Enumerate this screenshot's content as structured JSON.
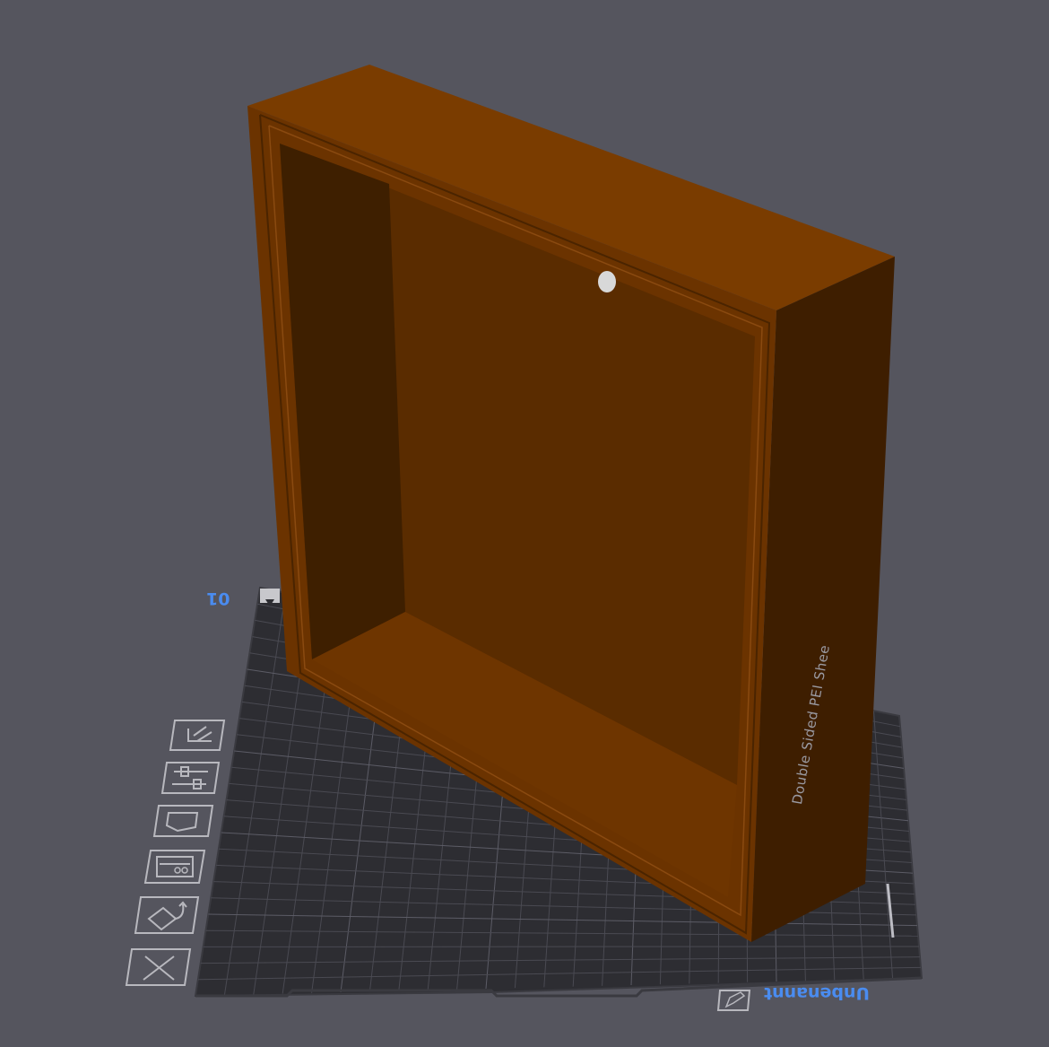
{
  "viewport": {
    "background_color": "#55555e",
    "plate_color": "#2d2d32",
    "grid_color": "#4a4a52",
    "model_color": "#6b3300",
    "accent_color": "#4a8cf0"
  },
  "plate": {
    "number": "01",
    "name": "Unbenannt",
    "surface_label": "Double Sided PEI Shee"
  },
  "toolbar": {
    "tools": [
      {
        "name": "arrange-icon"
      },
      {
        "name": "layer-settings-icon"
      },
      {
        "name": "cut-icon"
      },
      {
        "name": "plate-layout-icon"
      },
      {
        "name": "auto-orient-icon"
      },
      {
        "name": "delete-plate-icon"
      }
    ],
    "edit_plate": {
      "name": "edit-plate-icon"
    }
  }
}
